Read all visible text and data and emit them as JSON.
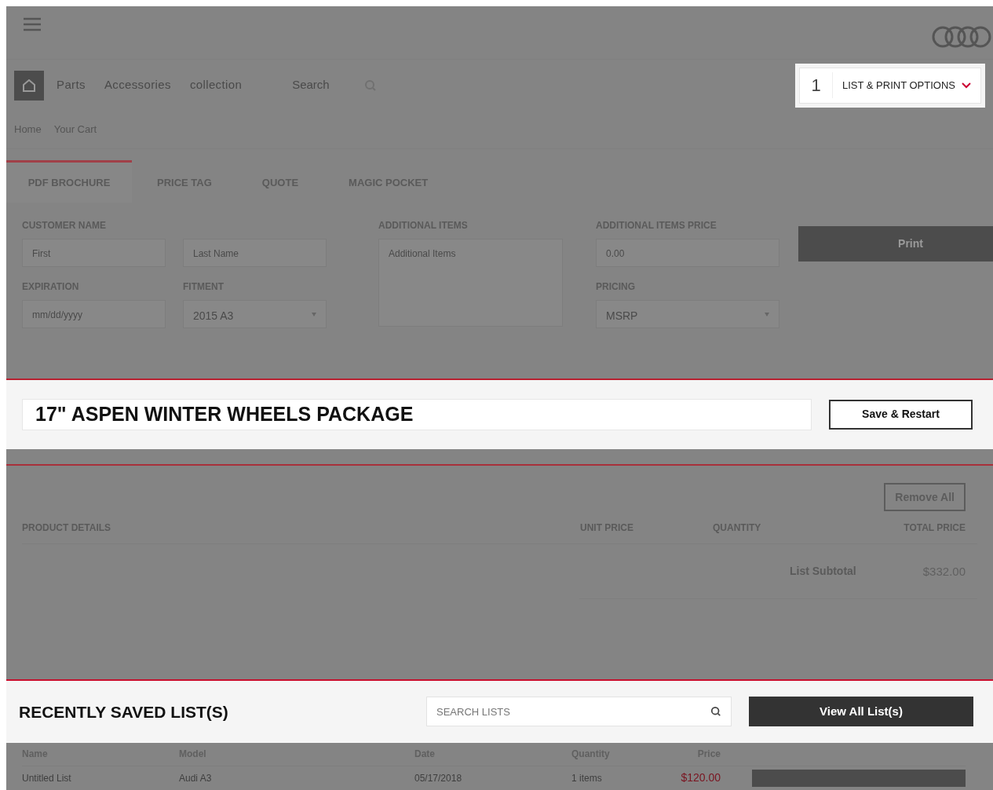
{
  "header": {
    "nav_links": [
      "Parts",
      "Accessories",
      "collection"
    ],
    "search_placeholder": "Search"
  },
  "list_options": {
    "count": "1",
    "label": "LIST & PRINT OPTIONS"
  },
  "breadcrumb": [
    "Home",
    "Your Cart"
  ],
  "tabs": [
    {
      "label": "PDF BROCHURE",
      "selected": true
    },
    {
      "label": "PRICE TAG",
      "selected": false
    },
    {
      "label": "QUOTE",
      "selected": false
    },
    {
      "label": "MAGIC POCKET",
      "selected": false
    }
  ],
  "form": {
    "customer_name_label": "CUSTOMER NAME",
    "first_placeholder": "First",
    "last_placeholder": "Last Name",
    "expiration_label": "EXPIRATION",
    "expiration_placeholder": "mm/dd/yyyy",
    "fitment_label": "FITMENT",
    "fitment_value": "2015 A3",
    "additional_items_label": "ADDITIONAL ITEMS",
    "additional_items_placeholder": "Additional Items",
    "additional_price_label": "ADDITIONAL ITEMS PRICE",
    "additional_price_placeholder": "0.00",
    "pricing_label": "PRICING",
    "pricing_value": "MSRP",
    "print_button": "Print"
  },
  "list_title": "17\" ASPEN WINTER WHEELS PACKAGE",
  "save_button": "Save & Restart",
  "cart": {
    "remove_all": "Remove All",
    "columns": [
      "PRODUCT DETAILS",
      "UNIT PRICE",
      "QUANTITY",
      "TOTAL PRICE"
    ],
    "subtotal_label": "List Subtotal",
    "subtotal_value": "$332.00"
  },
  "recent": {
    "title": "RECENTLY SAVED LIST(S)",
    "search_placeholder": "SEARCH LISTS",
    "view_all": "View All List(s)",
    "columns": [
      "Name",
      "Model",
      "Date",
      "Quantity",
      "Price"
    ],
    "rows": [
      {
        "name": "Untitled List",
        "model": "Audi A3",
        "date": "05/17/2018",
        "quantity": "1 items",
        "price": "$120.00"
      }
    ]
  }
}
